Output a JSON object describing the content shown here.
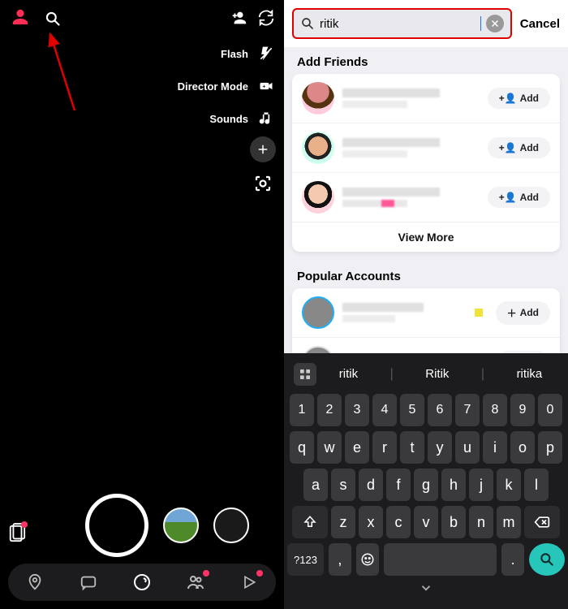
{
  "left": {
    "tools": {
      "flash": "Flash",
      "director": "Director Mode",
      "sounds": "Sounds"
    }
  },
  "right": {
    "search_value": "ritik",
    "cancel": "Cancel",
    "sections": {
      "add_friends": "Add Friends",
      "popular": "Popular Accounts"
    },
    "add_btn": "Add",
    "view_more": "View More"
  },
  "keyboard": {
    "suggestions": [
      "ritik",
      "Ritik",
      "ritika"
    ],
    "row1": [
      "1",
      "2",
      "3",
      "4",
      "5",
      "6",
      "7",
      "8",
      "9",
      "0"
    ],
    "row2": [
      "q",
      "w",
      "e",
      "r",
      "t",
      "y",
      "u",
      "i",
      "o",
      "p"
    ],
    "row3": [
      "a",
      "s",
      "d",
      "f",
      "g",
      "h",
      "j",
      "k",
      "l"
    ],
    "row4": [
      "z",
      "x",
      "c",
      "v",
      "b",
      "n",
      "m"
    ],
    "sym_key": "?123",
    "comma": ",",
    "period": "."
  }
}
